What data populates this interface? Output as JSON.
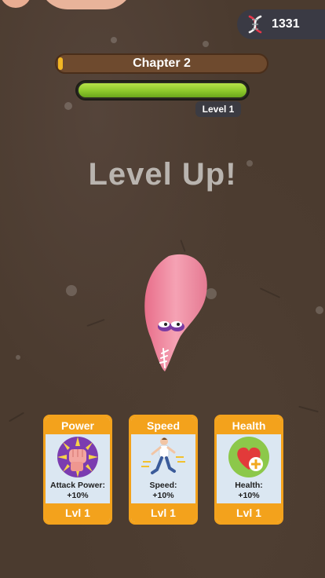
{
  "currency": {
    "icon": "dna-icon",
    "amount": "1331"
  },
  "chapter": {
    "label": "Chapter 2",
    "progress": 0.02
  },
  "xp": {
    "progress": 1.0,
    "level_label": "Level 1"
  },
  "banner": {
    "text": "Level Up!"
  },
  "cards": [
    {
      "title": "Power",
      "icon": "fist-icon",
      "desc_line1": "Attack Power:",
      "desc_line2": "+10%",
      "level": "Lvl 1"
    },
    {
      "title": "Speed",
      "icon": "runner-icon",
      "desc_line1": "Speed:",
      "desc_line2": "+10%",
      "level": "Lvl 1"
    },
    {
      "title": "Health",
      "icon": "heart-plus-icon",
      "desc_line1": "Health:",
      "desc_line2": "+10%",
      "level": "Lvl 1"
    }
  ],
  "colors": {
    "card_accent": "#f3a21c",
    "xp_green": "#8cc82b",
    "ground": "#4b3b2f",
    "worm": "#f08aa0"
  }
}
